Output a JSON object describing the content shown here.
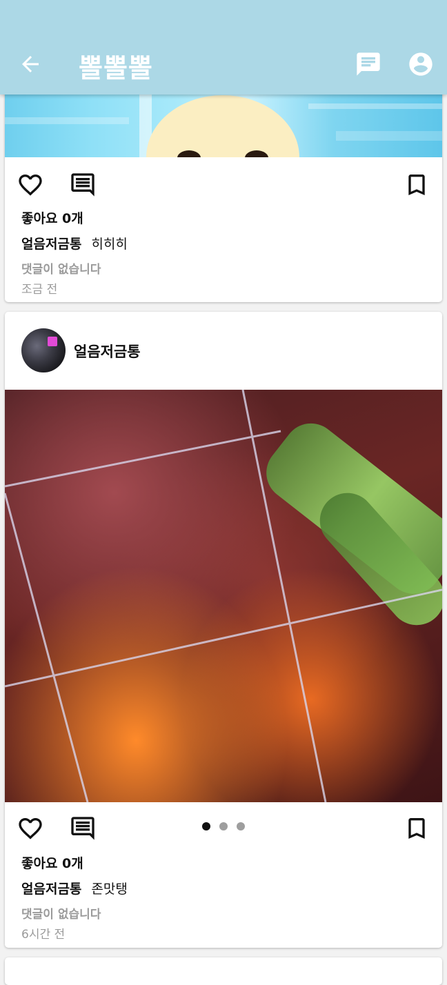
{
  "appbar": {
    "title": "뽈뽈뽈",
    "icons": [
      "arrow-back-icon",
      "chat-icon",
      "account-circle-icon"
    ]
  },
  "posts": [
    {
      "likes": "좋아요 0개",
      "username": "얼음저금통",
      "caption": "히히히",
      "comments": "댓글이 없습니다",
      "time": "조금 전"
    },
    {
      "username": "얼음저금통",
      "likes": "좋아요 0개",
      "caption_user": "얼음저금통",
      "caption": "존맛탱",
      "comments": "댓글이 없습니다",
      "time": "6시간 전",
      "carousel": {
        "count": 3,
        "active_index": 0
      }
    }
  ],
  "colors": {
    "appbar": "#acd8e6",
    "background": "#f2f2f2",
    "muted": "#9a9a9a"
  }
}
